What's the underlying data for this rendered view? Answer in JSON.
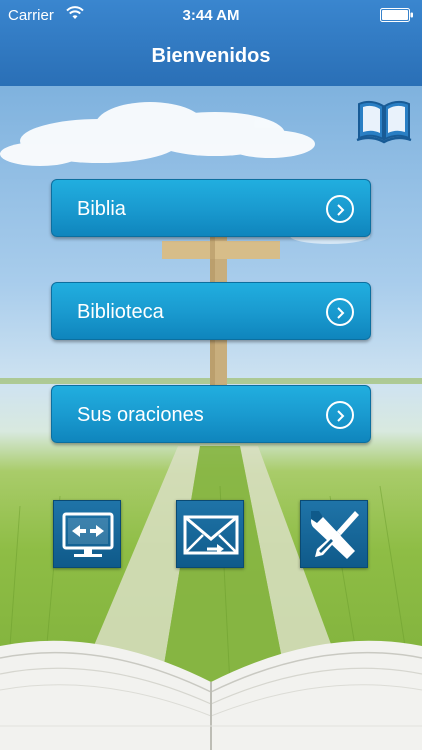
{
  "status_bar": {
    "carrier": "Carrier",
    "time": "3:44 AM"
  },
  "header": {
    "title": "Bienvenidos"
  },
  "menu": [
    {
      "label": "Biblia"
    },
    {
      "label": "Biblioteca"
    },
    {
      "label": "Sus oraciones"
    }
  ],
  "icons": {
    "top_right": "open-book-icon",
    "tools": [
      "monitor-arrows-icon",
      "envelope-icon",
      "wrench-screwdriver-icon"
    ]
  },
  "colors": {
    "header": "#2a6fb6",
    "button": "#1a9bd0",
    "tool_icon": "#0f5a8a",
    "book_icon": "#2a7fc4"
  }
}
